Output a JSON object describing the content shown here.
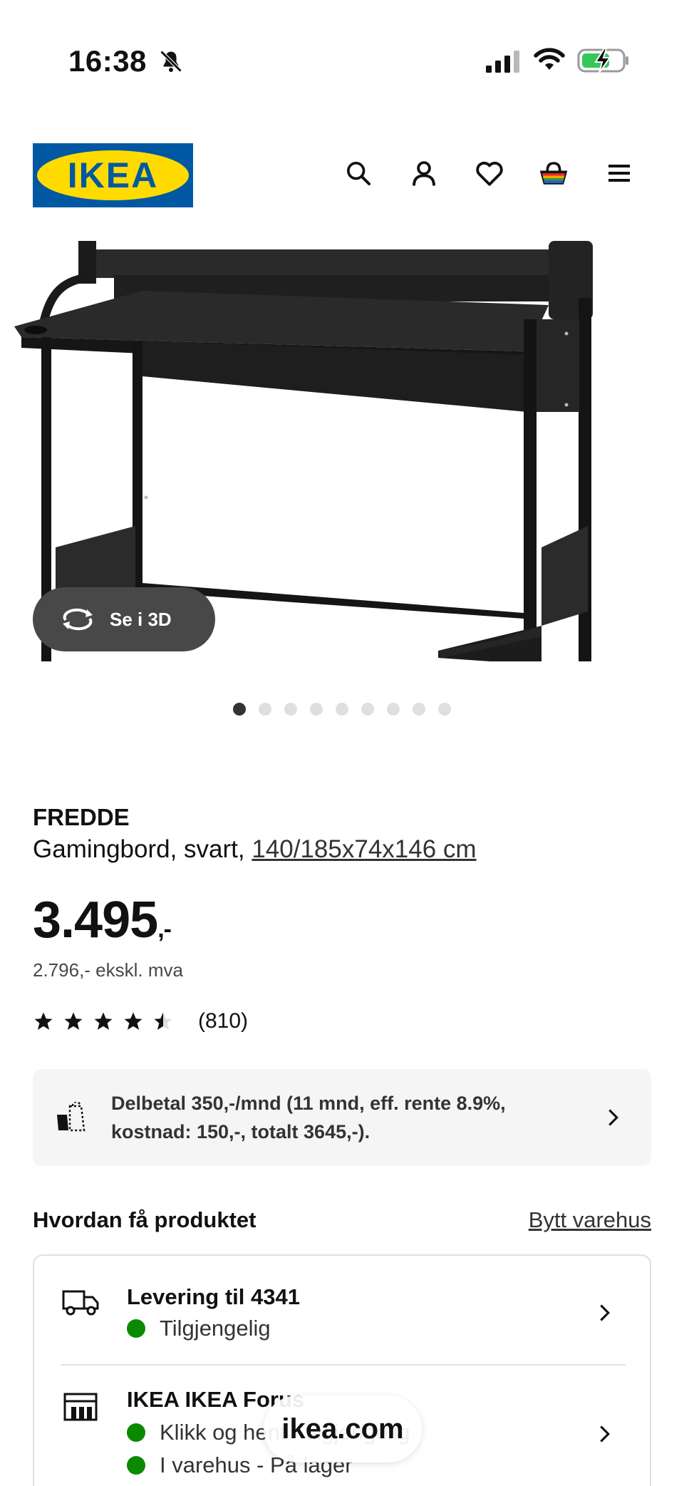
{
  "status_bar": {
    "time": "16:38",
    "icons": [
      "bell-slash-icon",
      "cellular-signal-icon",
      "wifi-icon",
      "battery-charging-icon"
    ]
  },
  "header": {
    "logo_text": "IKEA",
    "icons": [
      "search-icon",
      "user-icon",
      "heart-icon",
      "shopping-bag-icon",
      "menu-icon"
    ],
    "brand_blue": "#0058a3",
    "brand_yellow": "#ffdb00"
  },
  "gallery": {
    "view_3d_label": "Se i 3D",
    "dot_count": 9,
    "active_dot": 0
  },
  "product": {
    "name": "FREDDE",
    "description": "Gamingbord, svart, ",
    "dimensions": "140/185x74x146 cm",
    "price_main": "3.495",
    "price_suffix": ",-",
    "price_ex_vat": "2.796,- ekskl. mva",
    "rating_value": 4.5,
    "rating_count": "(810)"
  },
  "financing": {
    "text": "Delbetal 350,-/mnd (11 mnd, eff. rente 8.9%, kostnad: 150,-, totalt 3645,-)."
  },
  "availability": {
    "title": "Hvordan få produktet",
    "change_store": "Bytt varehus",
    "delivery": {
      "title": "Levering til 4341",
      "status": "Tilgjengelig",
      "status_color": "#0a8a00"
    },
    "store": {
      "title": "IKEA IKEA Forus",
      "click_collect": "Klikk og hent - tilgjengelig",
      "in_store": "I varehus - På lager"
    }
  },
  "browser": {
    "url": "ikea.com"
  }
}
